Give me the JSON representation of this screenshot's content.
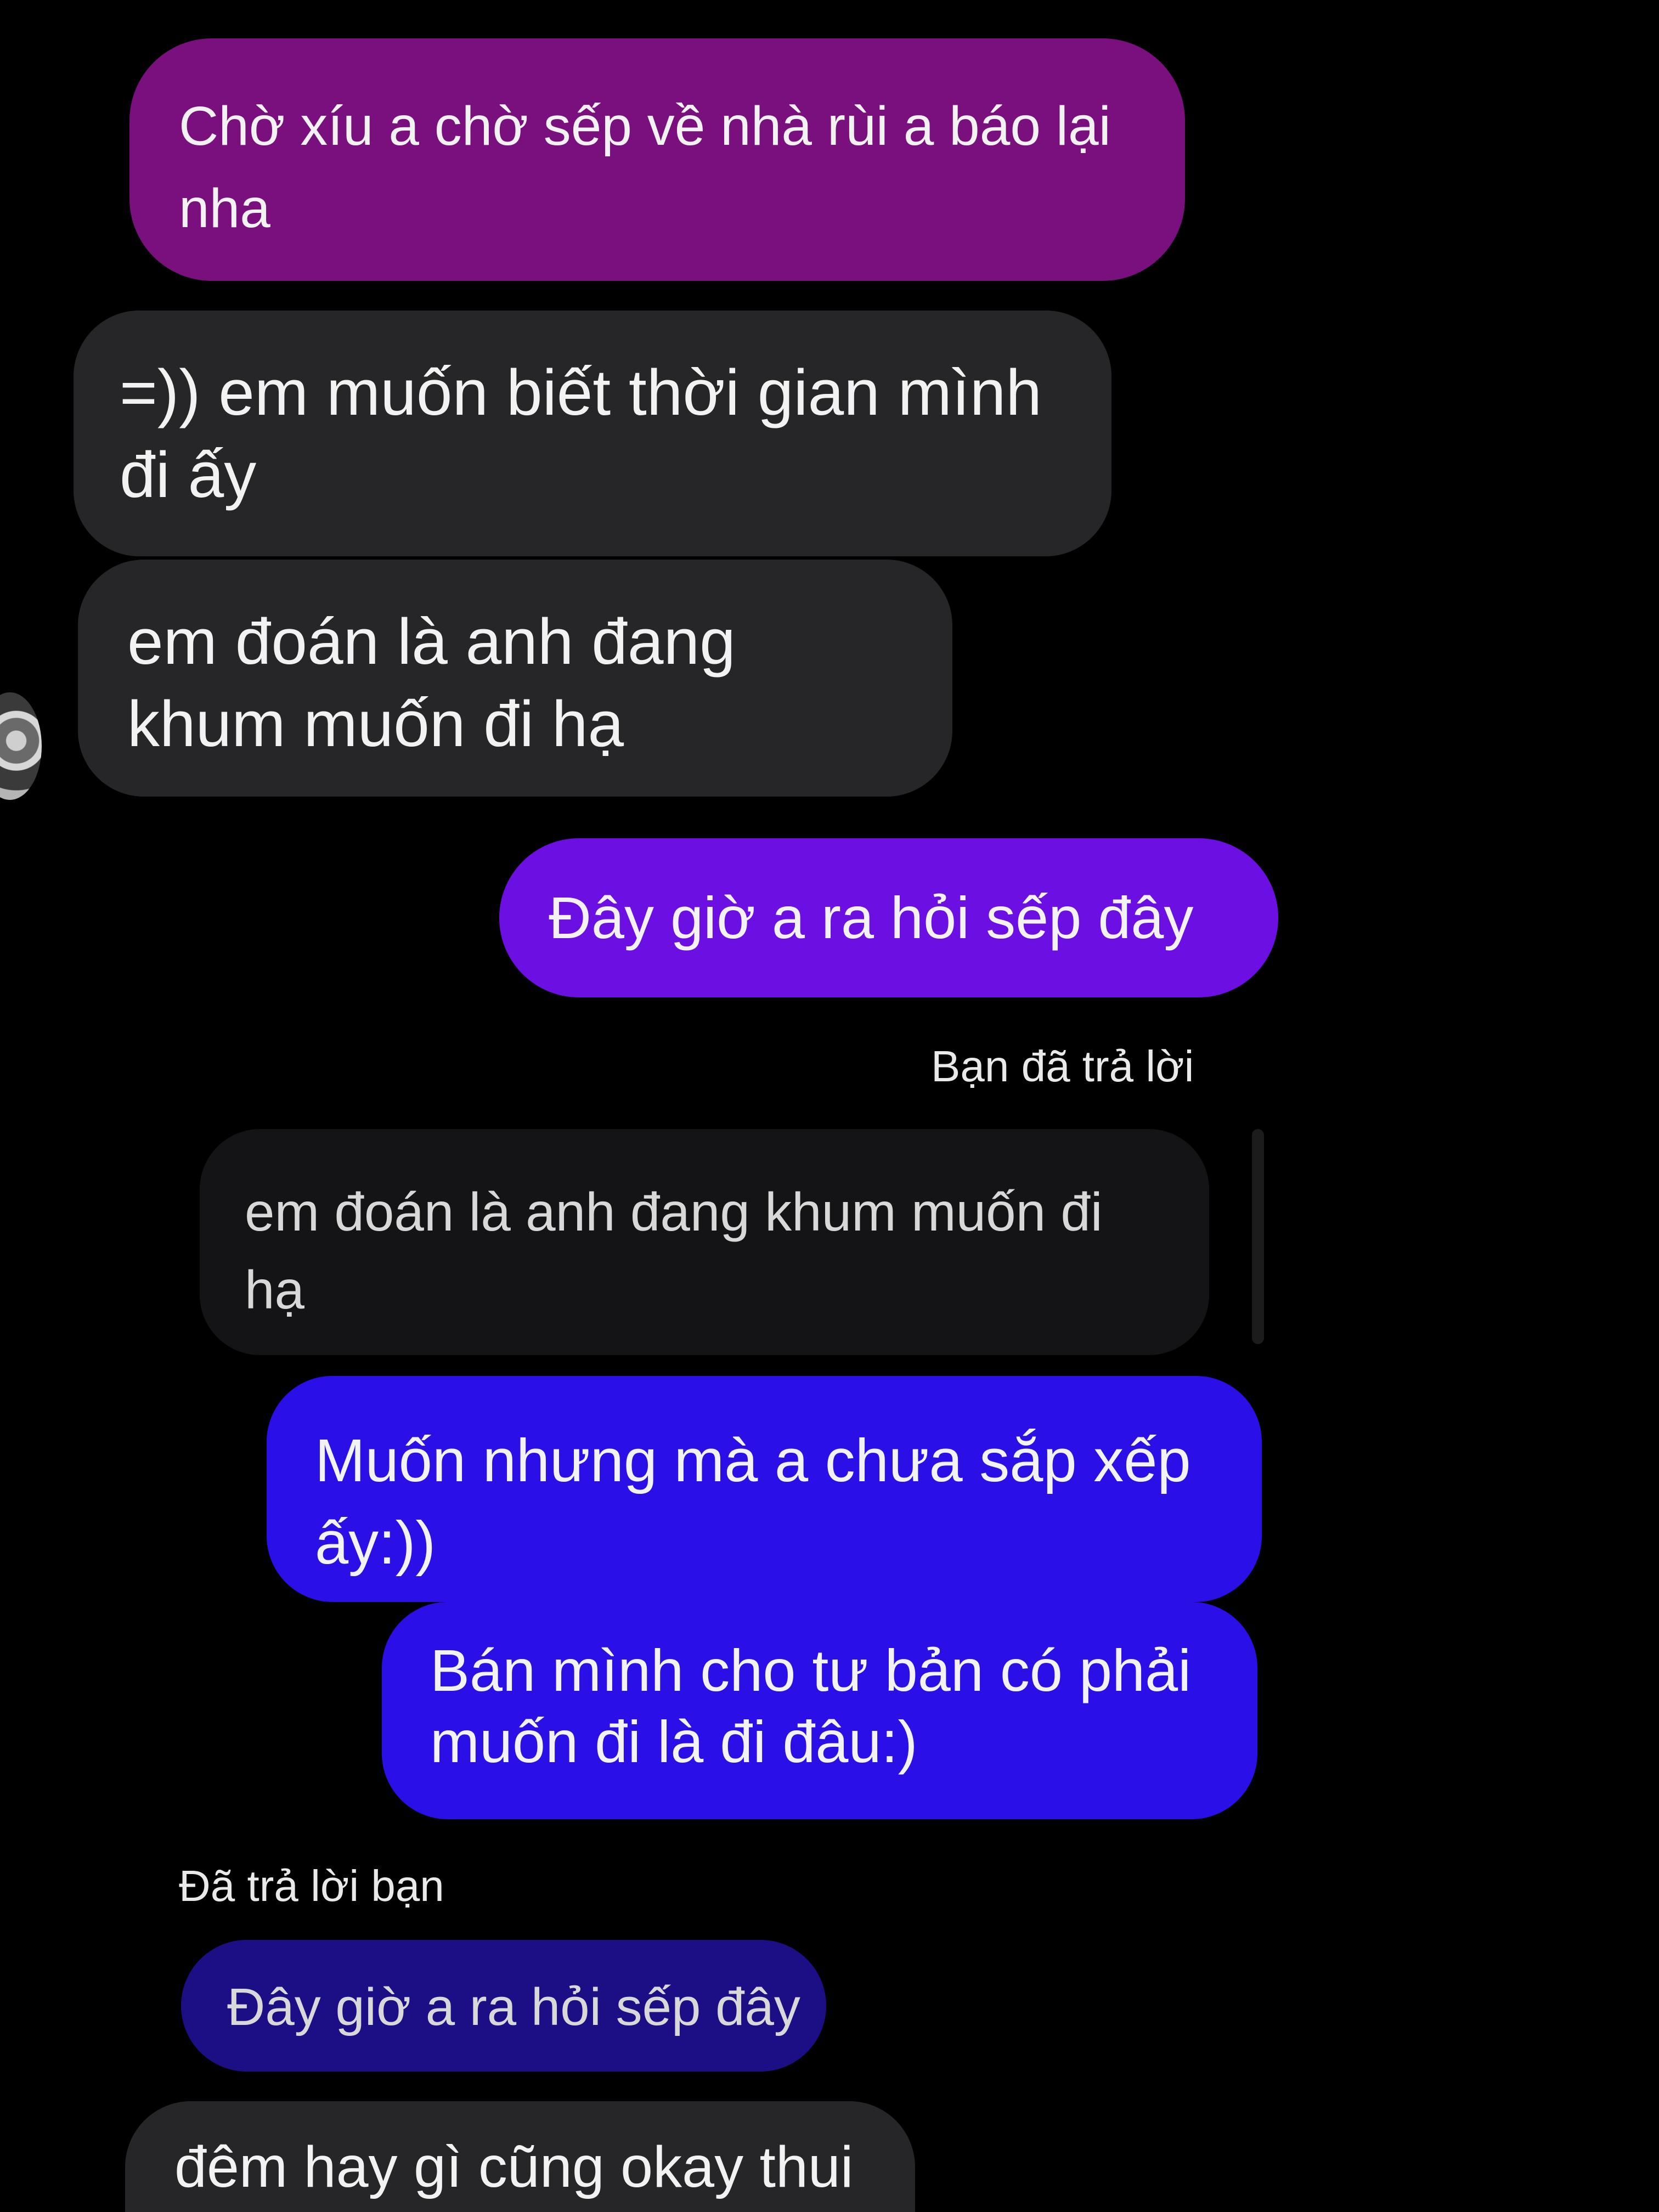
{
  "colors": {
    "background": "#000000",
    "outgoing_magenta": "#7a0f7e",
    "outgoing_violet": "#6b0fe3",
    "outgoing_blue": "#2a0fe6",
    "incoming_gray": "#262628",
    "quote_gray": "#141416",
    "quote_blue": "#1c0f86"
  },
  "messages": [
    {
      "id": "m1",
      "sender": "me",
      "text": "Chờ xíu a chờ sếp về nhà rùi a báo lại nha"
    },
    {
      "id": "m2",
      "sender": "them",
      "text": "=)) em muốn biết thời gian mình đi ấy"
    },
    {
      "id": "m3",
      "sender": "them",
      "text": "em đoán là anh đang khum muốn đi hạ"
    },
    {
      "id": "m4",
      "sender": "me",
      "text": "Đây giờ a ra hỏi sếp đây"
    }
  ],
  "reply_1": {
    "label": "Bạn đã trả lời",
    "quote": "em đoán là anh đang khum muốn đi hạ"
  },
  "messages_2": [
    {
      "id": "m5",
      "sender": "me",
      "text": "Muốn nhưng mà a chưa sắp xếp ấy:))"
    },
    {
      "id": "m6",
      "sender": "me",
      "text": "Bán mình cho tư bản có phải muốn đi là đi đâu:)"
    }
  ],
  "reply_2": {
    "label": "Đã trả lời bạn",
    "quote": "Đây giờ a ra hỏi sếp đây"
  },
  "messages_3": [
    {
      "id": "m7",
      "sender": "them",
      "text": "đêm hay gì cũng okay thui"
    }
  ],
  "icons": {
    "avatar": "profile-avatar-icon"
  }
}
